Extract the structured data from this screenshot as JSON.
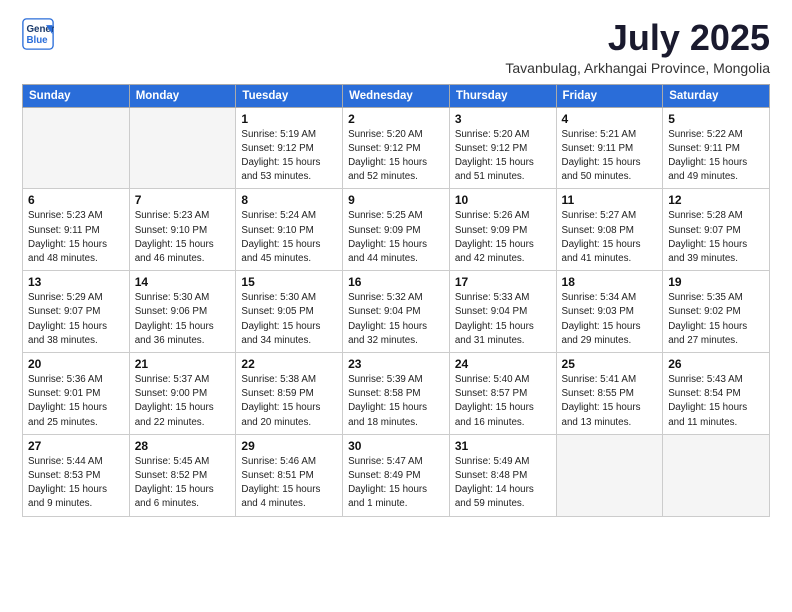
{
  "header": {
    "logo_line1": "General",
    "logo_line2": "Blue",
    "month_year": "July 2025",
    "location": "Tavanbulag, Arkhangai Province, Mongolia"
  },
  "weekdays": [
    "Sunday",
    "Monday",
    "Tuesday",
    "Wednesday",
    "Thursday",
    "Friday",
    "Saturday"
  ],
  "weeks": [
    [
      {
        "day": "",
        "info": ""
      },
      {
        "day": "",
        "info": ""
      },
      {
        "day": "1",
        "info": "Sunrise: 5:19 AM\nSunset: 9:12 PM\nDaylight: 15 hours\nand 53 minutes."
      },
      {
        "day": "2",
        "info": "Sunrise: 5:20 AM\nSunset: 9:12 PM\nDaylight: 15 hours\nand 52 minutes."
      },
      {
        "day": "3",
        "info": "Sunrise: 5:20 AM\nSunset: 9:12 PM\nDaylight: 15 hours\nand 51 minutes."
      },
      {
        "day": "4",
        "info": "Sunrise: 5:21 AM\nSunset: 9:11 PM\nDaylight: 15 hours\nand 50 minutes."
      },
      {
        "day": "5",
        "info": "Sunrise: 5:22 AM\nSunset: 9:11 PM\nDaylight: 15 hours\nand 49 minutes."
      }
    ],
    [
      {
        "day": "6",
        "info": "Sunrise: 5:23 AM\nSunset: 9:11 PM\nDaylight: 15 hours\nand 48 minutes."
      },
      {
        "day": "7",
        "info": "Sunrise: 5:23 AM\nSunset: 9:10 PM\nDaylight: 15 hours\nand 46 minutes."
      },
      {
        "day": "8",
        "info": "Sunrise: 5:24 AM\nSunset: 9:10 PM\nDaylight: 15 hours\nand 45 minutes."
      },
      {
        "day": "9",
        "info": "Sunrise: 5:25 AM\nSunset: 9:09 PM\nDaylight: 15 hours\nand 44 minutes."
      },
      {
        "day": "10",
        "info": "Sunrise: 5:26 AM\nSunset: 9:09 PM\nDaylight: 15 hours\nand 42 minutes."
      },
      {
        "day": "11",
        "info": "Sunrise: 5:27 AM\nSunset: 9:08 PM\nDaylight: 15 hours\nand 41 minutes."
      },
      {
        "day": "12",
        "info": "Sunrise: 5:28 AM\nSunset: 9:07 PM\nDaylight: 15 hours\nand 39 minutes."
      }
    ],
    [
      {
        "day": "13",
        "info": "Sunrise: 5:29 AM\nSunset: 9:07 PM\nDaylight: 15 hours\nand 38 minutes."
      },
      {
        "day": "14",
        "info": "Sunrise: 5:30 AM\nSunset: 9:06 PM\nDaylight: 15 hours\nand 36 minutes."
      },
      {
        "day": "15",
        "info": "Sunrise: 5:30 AM\nSunset: 9:05 PM\nDaylight: 15 hours\nand 34 minutes."
      },
      {
        "day": "16",
        "info": "Sunrise: 5:32 AM\nSunset: 9:04 PM\nDaylight: 15 hours\nand 32 minutes."
      },
      {
        "day": "17",
        "info": "Sunrise: 5:33 AM\nSunset: 9:04 PM\nDaylight: 15 hours\nand 31 minutes."
      },
      {
        "day": "18",
        "info": "Sunrise: 5:34 AM\nSunset: 9:03 PM\nDaylight: 15 hours\nand 29 minutes."
      },
      {
        "day": "19",
        "info": "Sunrise: 5:35 AM\nSunset: 9:02 PM\nDaylight: 15 hours\nand 27 minutes."
      }
    ],
    [
      {
        "day": "20",
        "info": "Sunrise: 5:36 AM\nSunset: 9:01 PM\nDaylight: 15 hours\nand 25 minutes."
      },
      {
        "day": "21",
        "info": "Sunrise: 5:37 AM\nSunset: 9:00 PM\nDaylight: 15 hours\nand 22 minutes."
      },
      {
        "day": "22",
        "info": "Sunrise: 5:38 AM\nSunset: 8:59 PM\nDaylight: 15 hours\nand 20 minutes."
      },
      {
        "day": "23",
        "info": "Sunrise: 5:39 AM\nSunset: 8:58 PM\nDaylight: 15 hours\nand 18 minutes."
      },
      {
        "day": "24",
        "info": "Sunrise: 5:40 AM\nSunset: 8:57 PM\nDaylight: 15 hours\nand 16 minutes."
      },
      {
        "day": "25",
        "info": "Sunrise: 5:41 AM\nSunset: 8:55 PM\nDaylight: 15 hours\nand 13 minutes."
      },
      {
        "day": "26",
        "info": "Sunrise: 5:43 AM\nSunset: 8:54 PM\nDaylight: 15 hours\nand 11 minutes."
      }
    ],
    [
      {
        "day": "27",
        "info": "Sunrise: 5:44 AM\nSunset: 8:53 PM\nDaylight: 15 hours\nand 9 minutes."
      },
      {
        "day": "28",
        "info": "Sunrise: 5:45 AM\nSunset: 8:52 PM\nDaylight: 15 hours\nand 6 minutes."
      },
      {
        "day": "29",
        "info": "Sunrise: 5:46 AM\nSunset: 8:51 PM\nDaylight: 15 hours\nand 4 minutes."
      },
      {
        "day": "30",
        "info": "Sunrise: 5:47 AM\nSunset: 8:49 PM\nDaylight: 15 hours\nand 1 minute."
      },
      {
        "day": "31",
        "info": "Sunrise: 5:49 AM\nSunset: 8:48 PM\nDaylight: 14 hours\nand 59 minutes."
      },
      {
        "day": "",
        "info": ""
      },
      {
        "day": "",
        "info": ""
      }
    ]
  ]
}
